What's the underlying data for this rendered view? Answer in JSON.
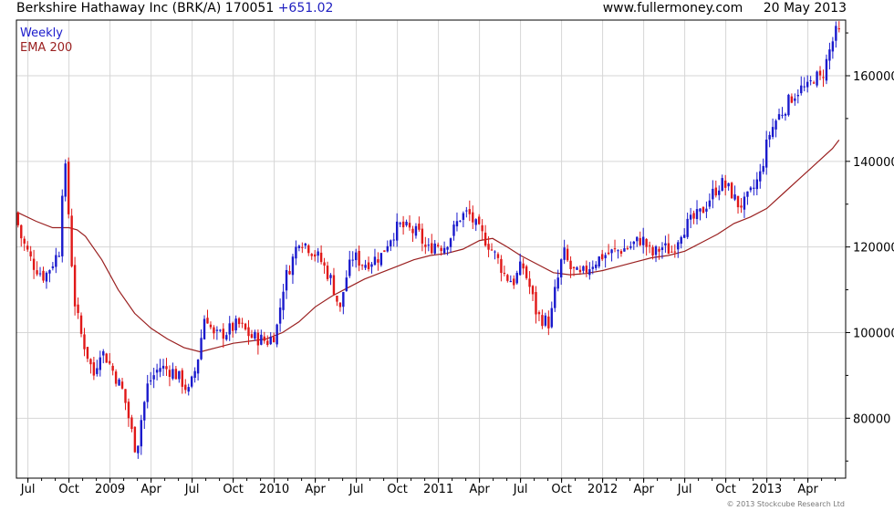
{
  "header": {
    "title": "Berkshire Hathaway Inc (BRK/A)",
    "price": "170051",
    "change": "+651.02",
    "site": "www.fullermoney.com",
    "date": "20 May 2013"
  },
  "legend": {
    "weekly": "Weekly",
    "ema": "EMA 200"
  },
  "credit": "© 2013 Stockcube Research Ltd",
  "colors": {
    "up": "#1a1acc",
    "down": "#e01818",
    "ema": "#9a2020",
    "grid": "#d6d6d6",
    "change_text": "#1f1fc0"
  },
  "chart_data": {
    "type": "candlestick",
    "frequency": "weekly",
    "ylim": [
      66000,
      173000
    ],
    "y_ticks": [
      80000,
      100000,
      120000,
      140000,
      160000
    ],
    "y_tick_labels": [
      "80000",
      "100000",
      "120000",
      "140000",
      "160000"
    ],
    "x_ticks": [
      {
        "label": "Jul",
        "t": 2008.5
      },
      {
        "label": "Oct",
        "t": 2008.75
      },
      {
        "label": "2009",
        "t": 2009.0
      },
      {
        "label": "Apr",
        "t": 2009.25
      },
      {
        "label": "Jul",
        "t": 2009.5
      },
      {
        "label": "Oct",
        "t": 2009.75
      },
      {
        "label": "2010",
        "t": 2010.0
      },
      {
        "label": "Apr",
        "t": 2010.25
      },
      {
        "label": "Jul",
        "t": 2010.5
      },
      {
        "label": "Oct",
        "t": 2010.75
      },
      {
        "label": "2011",
        "t": 2011.0
      },
      {
        "label": "Apr",
        "t": 2011.25
      },
      {
        "label": "Jul",
        "t": 2011.5
      },
      {
        "label": "Oct",
        "t": 2011.75
      },
      {
        "label": "2012",
        "t": 2012.0
      },
      {
        "label": "Apr",
        "t": 2012.25
      },
      {
        "label": "Jul",
        "t": 2012.5
      },
      {
        "label": "Oct",
        "t": 2012.75
      },
      {
        "label": "2013",
        "t": 2013.0
      },
      {
        "label": "Apr",
        "t": 2013.25
      }
    ],
    "xlim": [
      2008.43,
      2013.48
    ],
    "price_path": [
      [
        2008.44,
        128000
      ],
      [
        2008.48,
        122000
      ],
      [
        2008.55,
        116000
      ],
      [
        2008.62,
        113000
      ],
      [
        2008.68,
        117000
      ],
      [
        2008.72,
        120000
      ],
      [
        2008.735,
        144000
      ],
      [
        2008.76,
        132000
      ],
      [
        2008.8,
        108000
      ],
      [
        2008.84,
        100000
      ],
      [
        2008.88,
        95000
      ],
      [
        2008.92,
        90000
      ],
      [
        2008.96,
        96000
      ],
      [
        2009.0,
        94000
      ],
      [
        2009.05,
        90000
      ],
      [
        2009.1,
        86000
      ],
      [
        2009.15,
        77000
      ],
      [
        2009.18,
        72000
      ],
      [
        2009.21,
        80000
      ],
      [
        2009.25,
        88000
      ],
      [
        2009.32,
        92000
      ],
      [
        2009.4,
        91000
      ],
      [
        2009.45,
        89000
      ],
      [
        2009.5,
        86000
      ],
      [
        2009.55,
        93000
      ],
      [
        2009.6,
        105000
      ],
      [
        2009.65,
        99000
      ],
      [
        2009.72,
        100000
      ],
      [
        2009.8,
        102000
      ],
      [
        2009.88,
        99000
      ],
      [
        2009.98,
        98000
      ],
      [
        2010.03,
        100000
      ],
      [
        2010.08,
        112000
      ],
      [
        2010.13,
        117000
      ],
      [
        2010.17,
        122000
      ],
      [
        2010.23,
        120000
      ],
      [
        2010.3,
        117000
      ],
      [
        2010.37,
        112000
      ],
      [
        2010.42,
        105000
      ],
      [
        2010.45,
        112000
      ],
      [
        2010.5,
        118000
      ],
      [
        2010.56,
        116000
      ],
      [
        2010.62,
        117000
      ],
      [
        2010.67,
        118000
      ],
      [
        2010.72,
        122000
      ],
      [
        2010.78,
        125000
      ],
      [
        2010.84,
        124000
      ],
      [
        2010.9,
        123000
      ],
      [
        2010.95,
        119000
      ],
      [
        2011.0,
        121000
      ],
      [
        2011.05,
        120000
      ],
      [
        2011.1,
        123000
      ],
      [
        2011.15,
        127000
      ],
      [
        2011.2,
        128000
      ],
      [
        2011.26,
        124000
      ],
      [
        2011.32,
        121000
      ],
      [
        2011.38,
        117000
      ],
      [
        2011.43,
        113000
      ],
      [
        2011.48,
        112000
      ],
      [
        2011.53,
        116000
      ],
      [
        2011.58,
        110000
      ],
      [
        2011.62,
        104000
      ],
      [
        2011.66,
        103000
      ],
      [
        2011.7,
        102000
      ],
      [
        2011.72,
        108000
      ],
      [
        2011.75,
        113000
      ],
      [
        2011.78,
        119000
      ],
      [
        2011.82,
        115000
      ],
      [
        2011.88,
        113000
      ],
      [
        2011.95,
        116000
      ],
      [
        2012.02,
        118000
      ],
      [
        2012.1,
        119000
      ],
      [
        2012.18,
        120000
      ],
      [
        2012.26,
        122000
      ],
      [
        2012.32,
        118000
      ],
      [
        2012.38,
        120000
      ],
      [
        2012.44,
        119000
      ],
      [
        2012.5,
        124000
      ],
      [
        2012.56,
        126000
      ],
      [
        2012.62,
        128000
      ],
      [
        2012.68,
        132000
      ],
      [
        2012.74,
        135000
      ],
      [
        2012.8,
        133000
      ],
      [
        2012.84,
        130000
      ],
      [
        2012.88,
        130000
      ],
      [
        2012.93,
        133000
      ],
      [
        2012.98,
        137000
      ],
      [
        2013.03,
        146000
      ],
      [
        2013.08,
        150000
      ],
      [
        2013.12,
        152000
      ],
      [
        2013.17,
        155000
      ],
      [
        2013.22,
        157000
      ],
      [
        2013.27,
        157000
      ],
      [
        2013.31,
        160000
      ],
      [
        2013.35,
        159000
      ],
      [
        2013.38,
        163000
      ],
      [
        2013.41,
        167000
      ],
      [
        2013.44,
        170000
      ]
    ],
    "ema_200": [
      [
        2008.44,
        128000
      ],
      [
        2008.55,
        126000
      ],
      [
        2008.65,
        124500
      ],
      [
        2008.75,
        124500
      ],
      [
        2008.8,
        124000
      ],
      [
        2008.85,
        122500
      ],
      [
        2008.95,
        117000
      ],
      [
        2009.05,
        110000
      ],
      [
        2009.15,
        104500
      ],
      [
        2009.25,
        101000
      ],
      [
        2009.35,
        98500
      ],
      [
        2009.45,
        96500
      ],
      [
        2009.55,
        95500
      ],
      [
        2009.65,
        96500
      ],
      [
        2009.75,
        97500
      ],
      [
        2009.85,
        98000
      ],
      [
        2009.95,
        98500
      ],
      [
        2010.05,
        100000
      ],
      [
        2010.15,
        102500
      ],
      [
        2010.25,
        106000
      ],
      [
        2010.35,
        108500
      ],
      [
        2010.45,
        110500
      ],
      [
        2010.55,
        112500
      ],
      [
        2010.65,
        114000
      ],
      [
        2010.75,
        115500
      ],
      [
        2010.85,
        117000
      ],
      [
        2010.95,
        118000
      ],
      [
        2011.05,
        118500
      ],
      [
        2011.15,
        119500
      ],
      [
        2011.25,
        121500
      ],
      [
        2011.33,
        122000
      ],
      [
        2011.42,
        120000
      ],
      [
        2011.5,
        118000
      ],
      [
        2011.6,
        116000
      ],
      [
        2011.7,
        114000
      ],
      [
        2011.8,
        113500
      ],
      [
        2011.9,
        113800
      ],
      [
        2012.0,
        114500
      ],
      [
        2012.1,
        115500
      ],
      [
        2012.2,
        116500
      ],
      [
        2012.3,
        117500
      ],
      [
        2012.4,
        118000
      ],
      [
        2012.5,
        119000
      ],
      [
        2012.6,
        121000
      ],
      [
        2012.7,
        123000
      ],
      [
        2012.8,
        125500
      ],
      [
        2012.9,
        127000
      ],
      [
        2013.0,
        129000
      ],
      [
        2013.1,
        132500
      ],
      [
        2013.2,
        136000
      ],
      [
        2013.3,
        139500
      ],
      [
        2013.4,
        143000
      ],
      [
        2013.44,
        145000
      ]
    ]
  }
}
